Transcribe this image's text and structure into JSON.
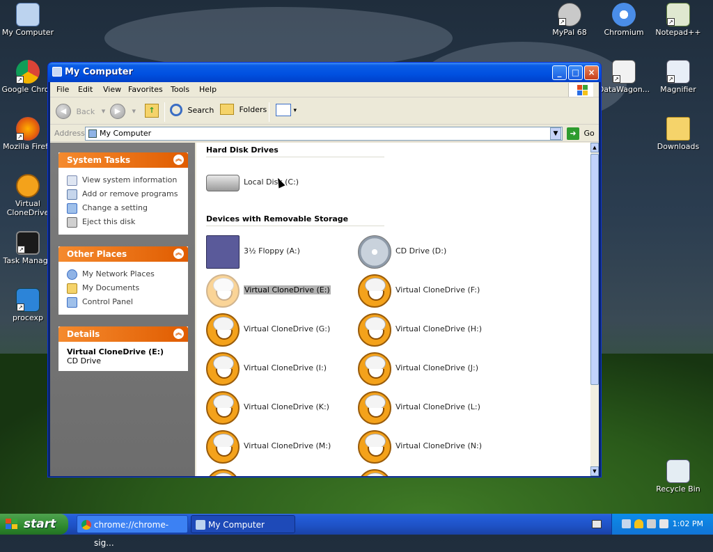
{
  "desktop": {
    "icons_left": [
      {
        "label": "My Computer",
        "icon": "computer-icon"
      },
      {
        "label": "Google Chron",
        "icon": "chrome-icon"
      },
      {
        "label": "Mozilla Firefo",
        "icon": "firefox-icon"
      },
      {
        "label": "Virtual CloneDrive",
        "icon": "clonedrive-sheep-icon"
      },
      {
        "label": "Task Manage",
        "icon": "task-manager-icon"
      },
      {
        "label": "procexp",
        "icon": "procexp-icon"
      }
    ],
    "icons_right": [
      {
        "label": "MyPal 68",
        "icon": "mypal-icon"
      },
      {
        "label": "Chromium",
        "icon": "chromium-icon"
      },
      {
        "label": "Notepad++",
        "icon": "notepadpp-icon"
      },
      {
        "label": "DataWagon...",
        "icon": "datawagon-icon"
      },
      {
        "label": "Magnifier",
        "icon": "magnifier-icon"
      },
      {
        "label": "Downloads",
        "icon": "folder-icon"
      },
      {
        "label": "Recycle Bin",
        "icon": "recycle-bin-icon"
      }
    ]
  },
  "window": {
    "title": "My Computer",
    "controls": {
      "minimize": "_",
      "maximize": "□",
      "close": "×"
    },
    "menu": [
      "File",
      "Edit",
      "View",
      "Favorites",
      "Tools",
      "Help"
    ],
    "toolbar": {
      "back": "Back",
      "search": "Search",
      "folders": "Folders"
    },
    "address": {
      "label": "Address",
      "value": "My Computer",
      "go": "Go"
    },
    "panels": {
      "system_tasks": {
        "title": "System Tasks",
        "items": [
          "View system information",
          "Add or remove programs",
          "Change a setting",
          "Eject this disk"
        ]
      },
      "other_places": {
        "title": "Other Places",
        "items": [
          "My Network Places",
          "My Documents",
          "Control Panel"
        ]
      },
      "details": {
        "title": "Details",
        "name": "Virtual CloneDrive (E:)",
        "type": "CD Drive"
      }
    },
    "content": {
      "hard_disk_header": "Hard Disk Drives",
      "local_disk": "Local Disk (C:)",
      "removable_header": "Devices with Removable Storage",
      "drives": [
        "3½ Floppy (A:)",
        "CD Drive (D:)",
        "Virtual CloneDrive (E:)",
        "Virtual CloneDrive (F:)",
        "Virtual CloneDrive (G:)",
        "Virtual CloneDrive (H:)",
        "Virtual CloneDrive (I:)",
        "Virtual CloneDrive (J:)",
        "Virtual CloneDrive (K:)",
        "Virtual CloneDrive (L:)",
        "Virtual CloneDrive (M:)",
        "Virtual CloneDrive (N:)"
      ]
    }
  },
  "taskbar": {
    "start": "start",
    "buttons": [
      "chrome://chrome-sig...",
      "My Computer"
    ],
    "clock": "1:02 PM"
  }
}
